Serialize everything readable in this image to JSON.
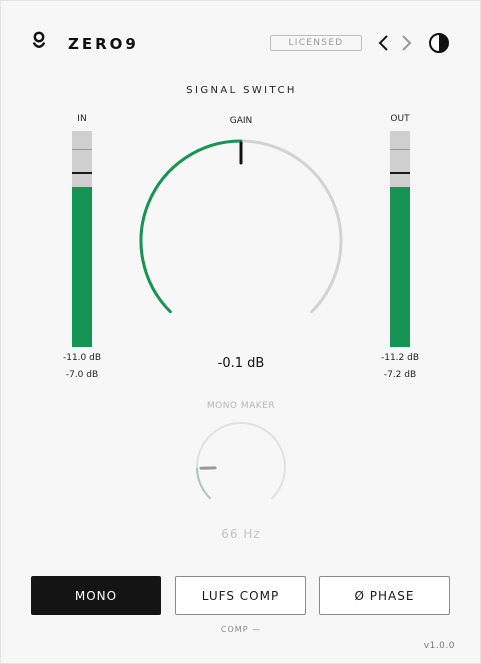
{
  "header": {
    "brand": "ZERO9",
    "license_badge": "LICENSED"
  },
  "section_title": "SIGNAL SWITCH",
  "input_meter": {
    "label": "IN",
    "level_fraction": 0.74,
    "readout_primary": "-11.0 dB",
    "readout_secondary": "-7.0 dB"
  },
  "output_meter": {
    "label": "OUT",
    "level_fraction": 0.74,
    "readout_primary": "-11.2 dB",
    "readout_secondary": "-7.2 dB"
  },
  "gain": {
    "label": "GAIN",
    "value_text": "-0.1 dB",
    "position_fraction": 0.5
  },
  "mono_maker": {
    "label": "MONO MAKER",
    "value_text": "66 Hz",
    "position_fraction": 0.16
  },
  "buttons": {
    "mono": "MONO",
    "lufs_comp": "LUFS COMP",
    "phase": "Ø PHASE"
  },
  "comp_status": "COMP —",
  "version": "v1.0.0",
  "colors": {
    "accent_green": "#169454",
    "meter_track": "#cfcfcf",
    "active_button": "#141414",
    "knob_track": "#d3d3d3"
  },
  "icons": {
    "logo": "zero9-logo-icon",
    "prev": "chevron-left-icon",
    "next": "chevron-right-icon",
    "theme": "contrast-toggle-icon"
  }
}
